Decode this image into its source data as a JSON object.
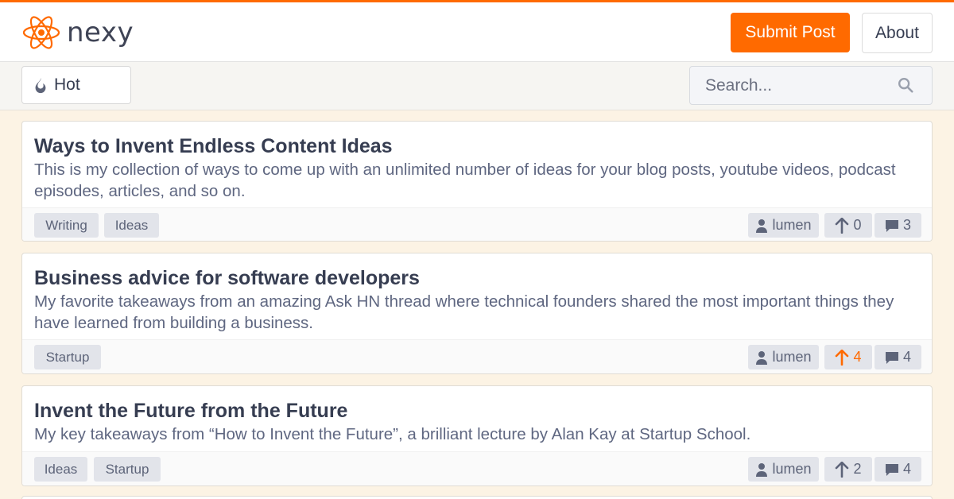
{
  "brand": {
    "name": "nexy",
    "accent": "#ff6a00"
  },
  "header": {
    "submit_label": "Submit Post",
    "about_label": "About"
  },
  "toolbar": {
    "sort_label": "Hot",
    "search_placeholder": "Search..."
  },
  "posts": [
    {
      "title": "Ways to Invent Endless Content Ideas",
      "desc": "This is my collection of ways to come up with an unlimited number of ideas for your blog posts, youtube videos, podcast episodes, articles, and so on.",
      "tags": [
        "Writing",
        "Ideas"
      ],
      "author": "lumen",
      "votes": "0",
      "comments": "3",
      "voted": false
    },
    {
      "title": "Business advice for software developers",
      "desc": "My favorite takeaways from an amazing Ask HN thread where technical founders shared the most important things they have learned from building a business.",
      "tags": [
        "Startup"
      ],
      "author": "lumen",
      "votes": "4",
      "comments": "4",
      "voted": true
    },
    {
      "title": "Invent the Future from the Future",
      "desc": "My key takeaways from “How to Invent the Future”, a brilliant lecture by Alan Kay at Startup School.",
      "tags": [
        "Ideas",
        "Startup"
      ],
      "author": "lumen",
      "votes": "2",
      "comments": "4",
      "voted": false
    }
  ],
  "icons": {
    "logo": "atom-logo-icon",
    "sort": "flame-icon",
    "search": "search-icon",
    "author": "user-icon",
    "votes": "arrow-up-icon",
    "comments": "comment-icon"
  }
}
